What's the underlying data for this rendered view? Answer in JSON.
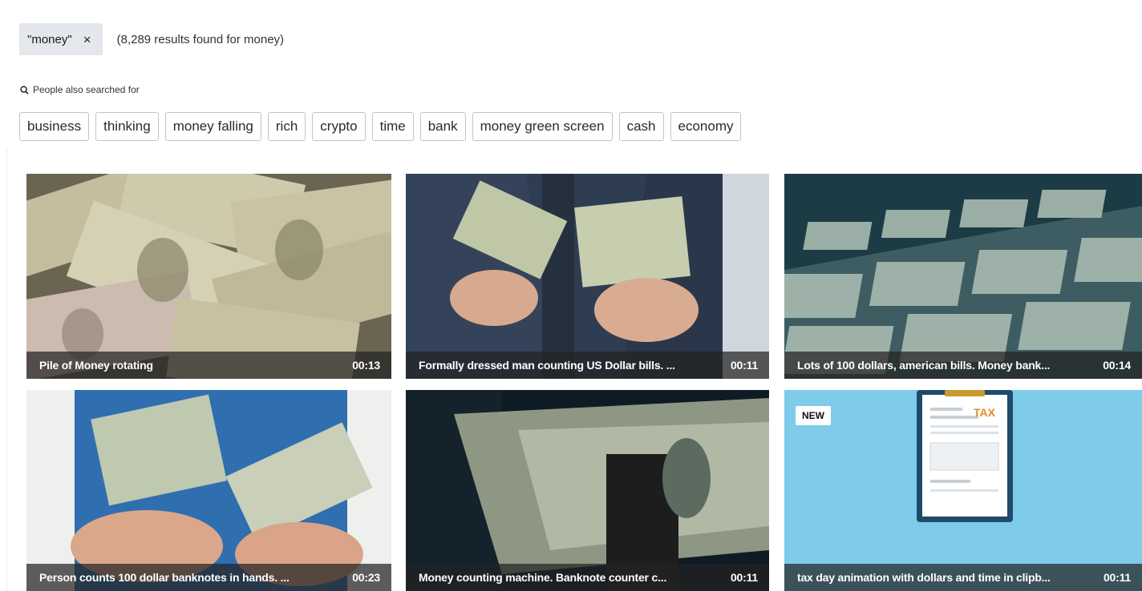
{
  "search": {
    "query_chip": "\"money\"",
    "close_glyph": "×",
    "results_text": "(8,289 results found for money)"
  },
  "also_searched": {
    "label": "People also searched for",
    "icon": "search-icon",
    "tags": [
      "business",
      "thinking",
      "money falling",
      "rich",
      "crypto",
      "time",
      "bank",
      "money green screen",
      "cash",
      "economy"
    ]
  },
  "results": [
    {
      "title": "Pile of Money rotating",
      "duration": "00:13"
    },
    {
      "title": "Formally dressed man counting US Dollar bills. ...",
      "duration": "00:11"
    },
    {
      "title": "Lots of 100 dollars, american bills. Money bank...",
      "duration": "00:14"
    },
    {
      "title": "Person counts 100 dollar banknotes in hands. ...",
      "duration": "00:23"
    },
    {
      "title": "Money counting machine. Banknote counter c...",
      "duration": "00:11"
    },
    {
      "title": "tax day animation with dollars and time in clipb...",
      "duration": "00:11",
      "badge": "NEW",
      "clipboard_text": "TAX"
    }
  ]
}
